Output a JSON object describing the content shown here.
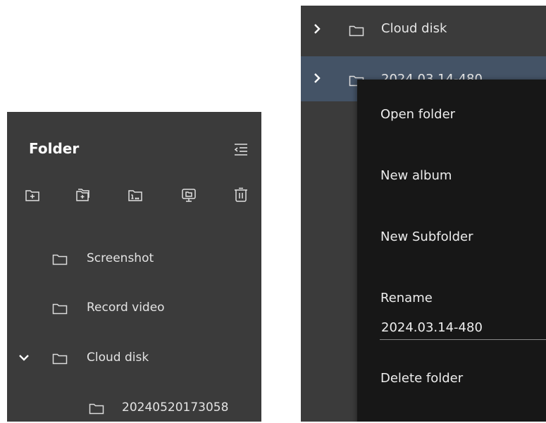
{
  "left": {
    "title": "Folder",
    "tree": [
      {
        "label": "Screenshot"
      },
      {
        "label": "Record video"
      },
      {
        "label": "Cloud disk"
      },
      {
        "label": "20240520173058"
      }
    ]
  },
  "right": {
    "rows": [
      {
        "label": "Cloud disk"
      },
      {
        "label": "2024.03.14-480"
      }
    ],
    "menu": {
      "open_folder": "Open folder",
      "new_album": "New album",
      "new_subfolder": "New Subfolder",
      "rename_label": "Rename",
      "rename_value": "2024.03.14-480",
      "delete_folder": "Delete folder"
    }
  },
  "colors": {
    "panel_bg": "#3b3b3b",
    "menu_bg": "#171717",
    "selected_row": "#445366",
    "text": "#e6e6e6"
  },
  "icons": {
    "collapse": "collapse-panel-icon",
    "toolbar": [
      "new-folder-icon",
      "add-folder-icon",
      "import-folder-icon",
      "display-folder-icon",
      "delete-icon"
    ],
    "folder": "folder-icon",
    "chevron_right": "chevron-right-icon",
    "chevron_down": "chevron-down-icon"
  }
}
